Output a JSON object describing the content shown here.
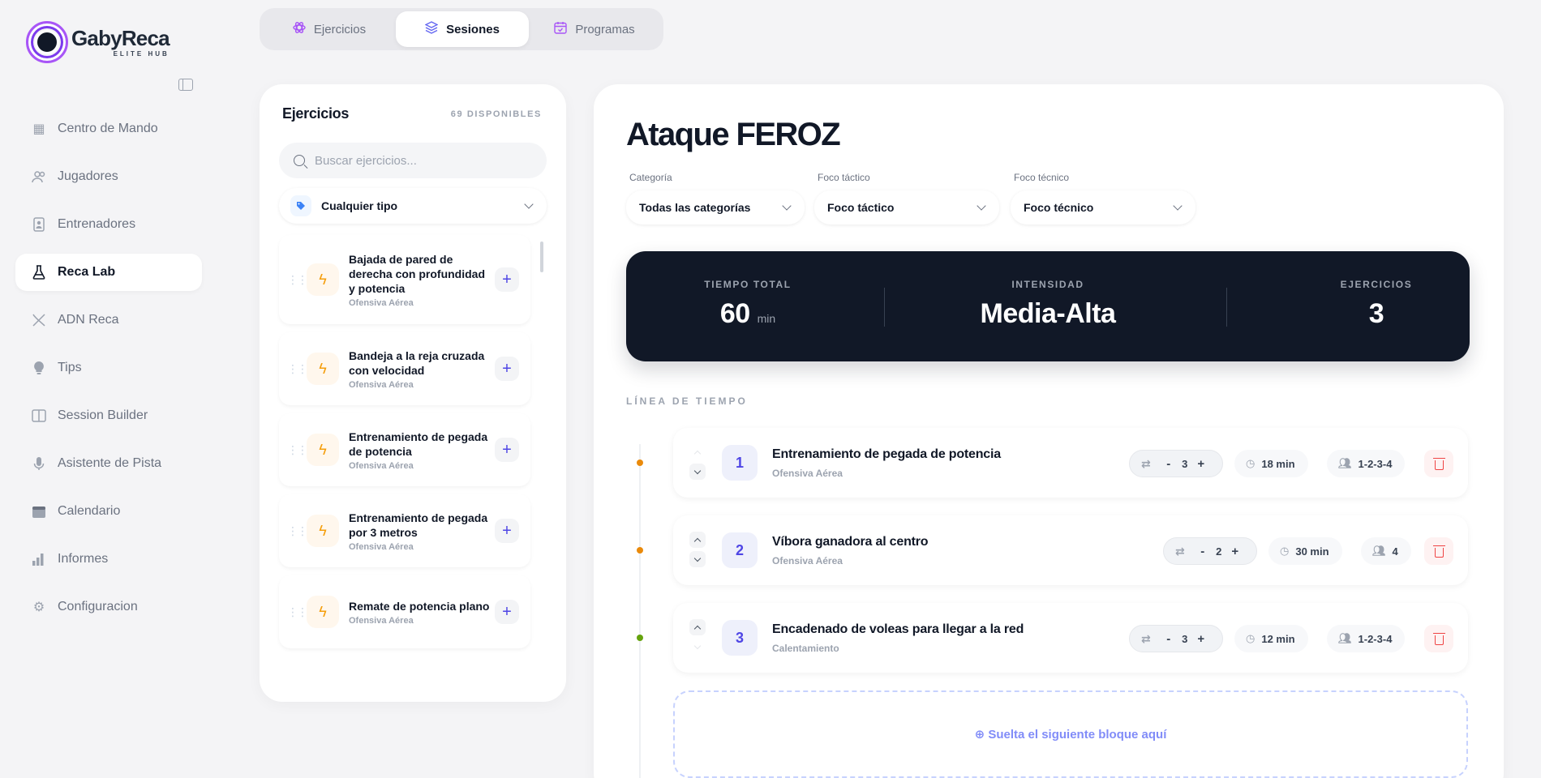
{
  "brand": {
    "name": "GabyReca",
    "tagline": "ELITE HUB"
  },
  "sidebar": {
    "items": [
      {
        "label": "Centro de Mando",
        "icon": "grid-icon",
        "active": false
      },
      {
        "label": "Jugadores",
        "icon": "users-icon",
        "active": false
      },
      {
        "label": "Entrenadores",
        "icon": "badge-icon",
        "active": false
      },
      {
        "label": "Reca Lab",
        "icon": "flask-icon",
        "active": true
      },
      {
        "label": "ADN Reca",
        "icon": "dna-icon",
        "active": false
      },
      {
        "label": "Tips",
        "icon": "lightbulb-icon",
        "active": false
      },
      {
        "label": "Session Builder",
        "icon": "columns-icon",
        "active": false
      },
      {
        "label": "Asistente de Pista",
        "icon": "microphone-icon",
        "active": false
      },
      {
        "label": "Calendario",
        "icon": "calendar-icon",
        "active": false
      },
      {
        "label": "Informes",
        "icon": "bar-chart-icon",
        "active": false
      },
      {
        "label": "Configuracion",
        "icon": "gear-icon",
        "active": false
      }
    ]
  },
  "tabs": [
    {
      "label": "Ejercicios",
      "icon": "atom-icon",
      "active": false
    },
    {
      "label": "Sesiones",
      "icon": "layers-icon",
      "active": true
    },
    {
      "label": "Programas",
      "icon": "calendar-check-icon",
      "active": false
    }
  ],
  "exercises": {
    "title": "Ejercicios",
    "count": "69 DISPONIBLES",
    "search_placeholder": "Buscar ejercicios...",
    "type_filter": "Cualquier tipo",
    "items": [
      {
        "name": "Bajada de pared de derecha con profundidad y potencia",
        "category": "Ofensiva Aérea"
      },
      {
        "name": "Bandeja a la reja cruzada con velocidad",
        "category": "Ofensiva Aérea"
      },
      {
        "name": "Entrenamiento de pegada de potencia",
        "category": "Ofensiva Aérea"
      },
      {
        "name": "Entrenamiento de pegada por 3 metros",
        "category": "Ofensiva Aérea"
      },
      {
        "name": "Remate de potencia plano",
        "category": "Ofensiva Aérea"
      }
    ]
  },
  "session": {
    "title": "Ataque FEROZ",
    "filters": [
      {
        "label": "Categoría",
        "value": "Todas las categorías"
      },
      {
        "label": "Foco táctico",
        "value": "Foco táctico"
      },
      {
        "label": "Foco técnico",
        "value": "Foco técnico"
      }
    ],
    "stats": {
      "time_label": "TIEMPO TOTAL",
      "time_value": "60",
      "time_unit": "min",
      "intensity_label": "INTENSIDAD",
      "intensity_value": "Media-Alta",
      "exercises_label": "EJERCICIOS",
      "exercises_value": "3"
    },
    "timeline_label": "LÍNEA DE TIEMPO",
    "blocks": [
      {
        "number": "1",
        "name": "Entrenamiento de pegada de potencia",
        "category": "Ofensiva Aérea",
        "reps": "3",
        "duration": "18 min",
        "players": "1-2-3-4",
        "dot_color": "#ea8a0b"
      },
      {
        "number": "2",
        "name": "Víbora ganadora al centro",
        "category": "Ofensiva Aérea",
        "reps": "2",
        "duration": "30 min",
        "players": "4",
        "dot_color": "#ea8a0b"
      },
      {
        "number": "3",
        "name": "Encadenado de voleas para llegar a la red",
        "category": "Calentamiento",
        "reps": "3",
        "duration": "12 min",
        "players": "1-2-3-4",
        "dot_color": "#65a30d"
      }
    ],
    "dropzone": "⊕ Suelta el siguiente bloque aquí"
  }
}
